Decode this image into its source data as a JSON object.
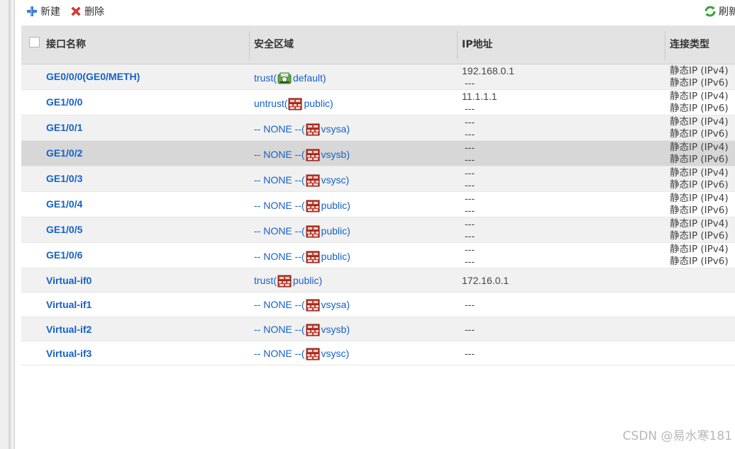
{
  "toolbar": {
    "new_label": "新建",
    "delete_label": "删除",
    "refresh_label": "刷新"
  },
  "columns": {
    "name": "接口名称",
    "zone": "安全区域",
    "ip": "IP地址",
    "conn": "连接类型"
  },
  "rows": [
    {
      "name": "GE0/0/0(GE0/METH)",
      "zone": "trust(",
      "vsys": "default)",
      "ip1": "192.168.0.1",
      "ip2": "---",
      "conn1": "静态IP (IPv4)",
      "conn2": "静态IP (IPv6)"
    },
    {
      "name": "GE1/0/0",
      "zone": "untrust(",
      "vsys": "public)",
      "ip1": "11.1.1.1",
      "ip2": "---",
      "conn1": "静态IP (IPv4)",
      "conn2": "静态IP (IPv6)"
    },
    {
      "name": "GE1/0/1",
      "zone": "-- NONE --(",
      "vsys": "vsysa)",
      "ip1": "---",
      "ip2": "---",
      "conn1": "静态IP (IPv4)",
      "conn2": "静态IP (IPv6)"
    },
    {
      "name": "GE1/0/2",
      "zone": "-- NONE --(",
      "vsys": "vsysb)",
      "ip1": "---",
      "ip2": "---",
      "conn1": "静态IP (IPv4)",
      "conn2": "静态IP (IPv6)"
    },
    {
      "name": "GE1/0/3",
      "zone": "-- NONE --(",
      "vsys": "vsysc)",
      "ip1": "---",
      "ip2": "---",
      "conn1": "静态IP (IPv4)",
      "conn2": "静态IP (IPv6)"
    },
    {
      "name": "GE1/0/4",
      "zone": "-- NONE --(",
      "vsys": "public)",
      "ip1": "---",
      "ip2": "---",
      "conn1": "静态IP (IPv4)",
      "conn2": "静态IP (IPv6)"
    },
    {
      "name": "GE1/0/5",
      "zone": "-- NONE --(",
      "vsys": "public)",
      "ip1": "---",
      "ip2": "---",
      "conn1": "静态IP (IPv4)",
      "conn2": "静态IP (IPv6)"
    },
    {
      "name": "GE1/0/6",
      "zone": "-- NONE --(",
      "vsys": "public)",
      "ip1": "---",
      "ip2": "---",
      "conn1": "静态IP (IPv4)",
      "conn2": "静态IP (IPv6)"
    },
    {
      "name": "Virtual-if0",
      "zone": "trust(",
      "vsys": "public)",
      "ip1": "172.16.0.1",
      "ip2": "",
      "conn1": "",
      "conn2": ""
    },
    {
      "name": "Virtual-if1",
      "zone": "-- NONE --(",
      "vsys": "vsysa)",
      "ip1": "---",
      "ip2": "",
      "conn1": "",
      "conn2": ""
    },
    {
      "name": "Virtual-if2",
      "zone": "-- NONE --(",
      "vsys": "vsysb)",
      "ip1": "---",
      "ip2": "",
      "conn1": "",
      "conn2": ""
    },
    {
      "name": "Virtual-if3",
      "zone": "-- NONE --(",
      "vsys": "vsysc)",
      "ip1": "---",
      "ip2": "",
      "conn1": "",
      "conn2": ""
    }
  ],
  "watermark": "CSDN @易水寒181",
  "colors": {
    "link": "#1561c9",
    "header_bg": "#e3e3e3",
    "row_alt": "#f1f1f1",
    "row_selected": "#d7d7d7"
  }
}
